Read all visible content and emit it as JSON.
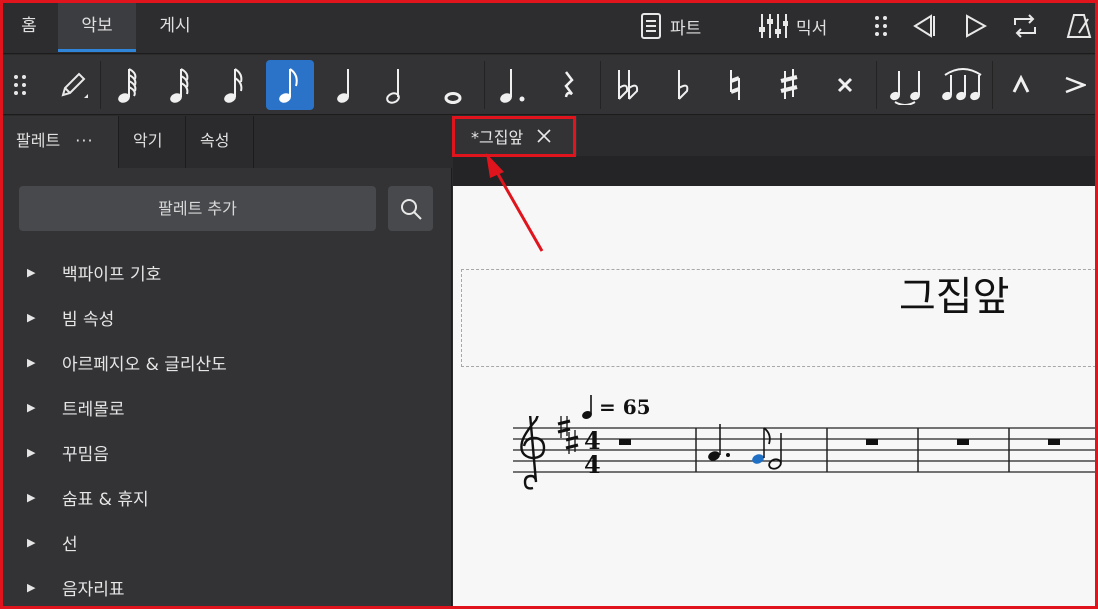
{
  "topbar": {
    "tabs": [
      {
        "label": "홈"
      },
      {
        "label": "악보"
      },
      {
        "label": "게시"
      }
    ],
    "parts_label": "파트",
    "mixer_label": "믹서"
  },
  "toolbar": {
    "selected_duration": "eighth-note"
  },
  "panel": {
    "tabs": {
      "palettes": "팔레트",
      "palettes_more": "···",
      "instruments": "악기",
      "properties": "속성"
    },
    "add_palette_label": "팔레트 추가",
    "palettes": [
      {
        "label": "백파이프 기호"
      },
      {
        "label": "빔 속성"
      },
      {
        "label": "아르페지오 & 글리산도"
      },
      {
        "label": "트레몰로"
      },
      {
        "label": "꾸밈음"
      },
      {
        "label": "숨표 & 휴지"
      },
      {
        "label": "선"
      },
      {
        "label": "음자리표"
      }
    ]
  },
  "score": {
    "tab_label": "*그집앞",
    "title": "그집앞",
    "tempo": "= 65",
    "time_signature_top": "4",
    "time_signature_bottom": "4"
  },
  "colors": {
    "accent": "#2a73c8",
    "highlight": "#e0141c",
    "selected_note": "#1f6fc4"
  }
}
